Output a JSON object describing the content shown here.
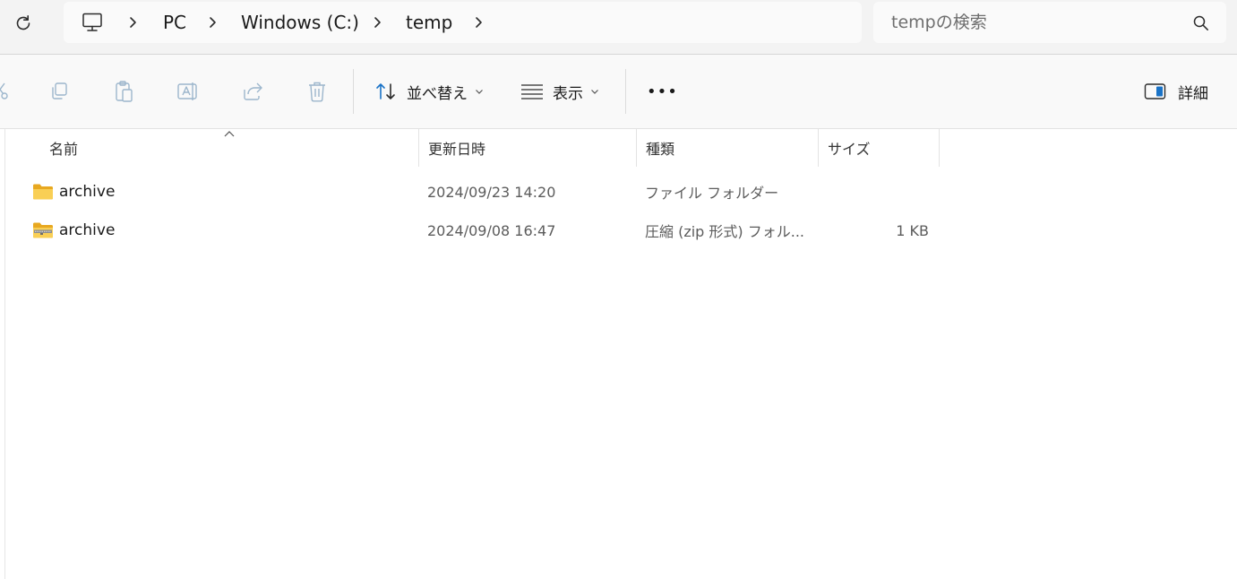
{
  "address_bar": {
    "breadcrumbs": [
      "PC",
      "Windows (C:)",
      "temp"
    ],
    "search_placeholder": "tempの検索"
  },
  "toolbar": {
    "sort_label": "並べ替え",
    "view_label": "表示",
    "more_label": "•••",
    "details_label": "詳細"
  },
  "columns": {
    "name": "名前",
    "date_modified": "更新日時",
    "type": "種類",
    "size": "サイズ"
  },
  "files": [
    {
      "name": "archive",
      "date_modified": "2024/09/23 14:20",
      "type": "ファイル フォルダー",
      "size": "",
      "icon": "folder-icon"
    },
    {
      "name": "archive",
      "date_modified": "2024/09/08 16:47",
      "type": "圧縮 (zip 形式) フォル...",
      "size": "1 KB",
      "icon": "zip-folder-icon"
    }
  ],
  "colors": {
    "accent": "#1a73c7",
    "folder_yellow": "#f4c542",
    "toolbar_disabled": "#9cb6cc"
  }
}
